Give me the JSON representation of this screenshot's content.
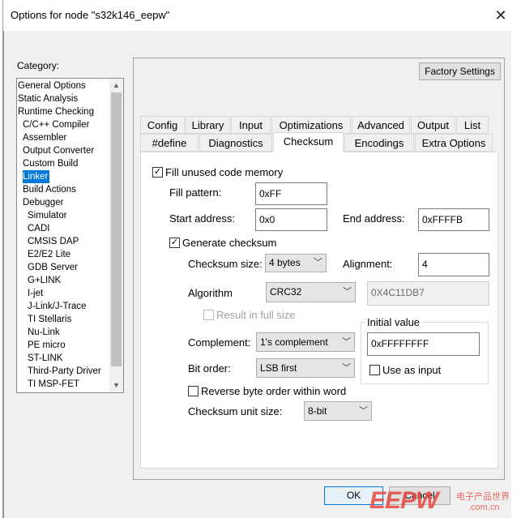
{
  "window": {
    "title": "Options for node \"s32k146_eepw\"",
    "close": "✕"
  },
  "category": {
    "label": "Category:",
    "items": [
      {
        "label": "General Options",
        "indent": 0
      },
      {
        "label": "Static Analysis",
        "indent": 0
      },
      {
        "label": "Runtime Checking",
        "indent": 0
      },
      {
        "label": "C/C++ Compiler",
        "indent": 1
      },
      {
        "label": "Assembler",
        "indent": 1
      },
      {
        "label": "Output Converter",
        "indent": 1
      },
      {
        "label": "Custom Build",
        "indent": 1
      },
      {
        "label": "Linker",
        "indent": 1,
        "selected": true
      },
      {
        "label": "Build Actions",
        "indent": 1
      },
      {
        "label": "Debugger",
        "indent": 1
      },
      {
        "label": "Simulator",
        "indent": 2
      },
      {
        "label": "CADI",
        "indent": 2
      },
      {
        "label": "CMSIS DAP",
        "indent": 2
      },
      {
        "label": "E2/E2 Lite",
        "indent": 2
      },
      {
        "label": "GDB Server",
        "indent": 2
      },
      {
        "label": "G+LINK",
        "indent": 2
      },
      {
        "label": "I-jet",
        "indent": 2
      },
      {
        "label": "J-Link/J-Trace",
        "indent": 2
      },
      {
        "label": "TI Stellaris",
        "indent": 2
      },
      {
        "label": "Nu-Link",
        "indent": 2
      },
      {
        "label": "PE micro",
        "indent": 2
      },
      {
        "label": "ST-LINK",
        "indent": 2
      },
      {
        "label": "Third-Party Driver",
        "indent": 2
      },
      {
        "label": "TI MSP-FET",
        "indent": 2
      }
    ]
  },
  "factory_settings": "Factory Settings",
  "tabs_row1": [
    "Config",
    "Library",
    "Input",
    "Optimizations",
    "Advanced",
    "Output",
    "List"
  ],
  "tabs_row2": [
    "#define",
    "Diagnostics",
    "Checksum",
    "Encodings",
    "Extra Options"
  ],
  "checksum": {
    "fill_unused": {
      "label": "Fill unused code memory",
      "checked": true
    },
    "fill_pattern": {
      "label": "Fill pattern:",
      "value": "0xFF"
    },
    "start_address": {
      "label": "Start address:",
      "value": "0x0"
    },
    "end_address": {
      "label": "End address:",
      "value": "0xFFFFB"
    },
    "generate": {
      "label": "Generate checksum",
      "checked": true
    },
    "checksum_size": {
      "label": "Checksum size:",
      "value": "4 bytes"
    },
    "alignment": {
      "label": "Alignment:",
      "value": "4"
    },
    "algorithm": {
      "label": "Algorithm",
      "value": "CRC32",
      "poly": "0X4C11DB7"
    },
    "result_full": {
      "label": "Result in full size",
      "checked": false
    },
    "initial_value": {
      "label": "Initial value",
      "value": "0xFFFFFFFF"
    },
    "use_as_input": {
      "label": "Use as input",
      "checked": false
    },
    "complement": {
      "label": "Complement:",
      "value": "1's complement"
    },
    "bit_order": {
      "label": "Bit order:",
      "value": "LSB first"
    },
    "reverse": {
      "label": "Reverse byte order within word",
      "checked": false
    },
    "unit_size": {
      "label": "Checksum unit size:",
      "value": "8-bit"
    }
  },
  "footer": {
    "ok": "OK",
    "cancel": "Cancel"
  },
  "watermark": {
    "logo": "EEPW",
    "cn": "电子产品世界",
    "url": ".com.cn"
  },
  "colors": {
    "selection": "#0078d7",
    "accent_focus": "#0078d7",
    "watermark": "#e8473f"
  }
}
